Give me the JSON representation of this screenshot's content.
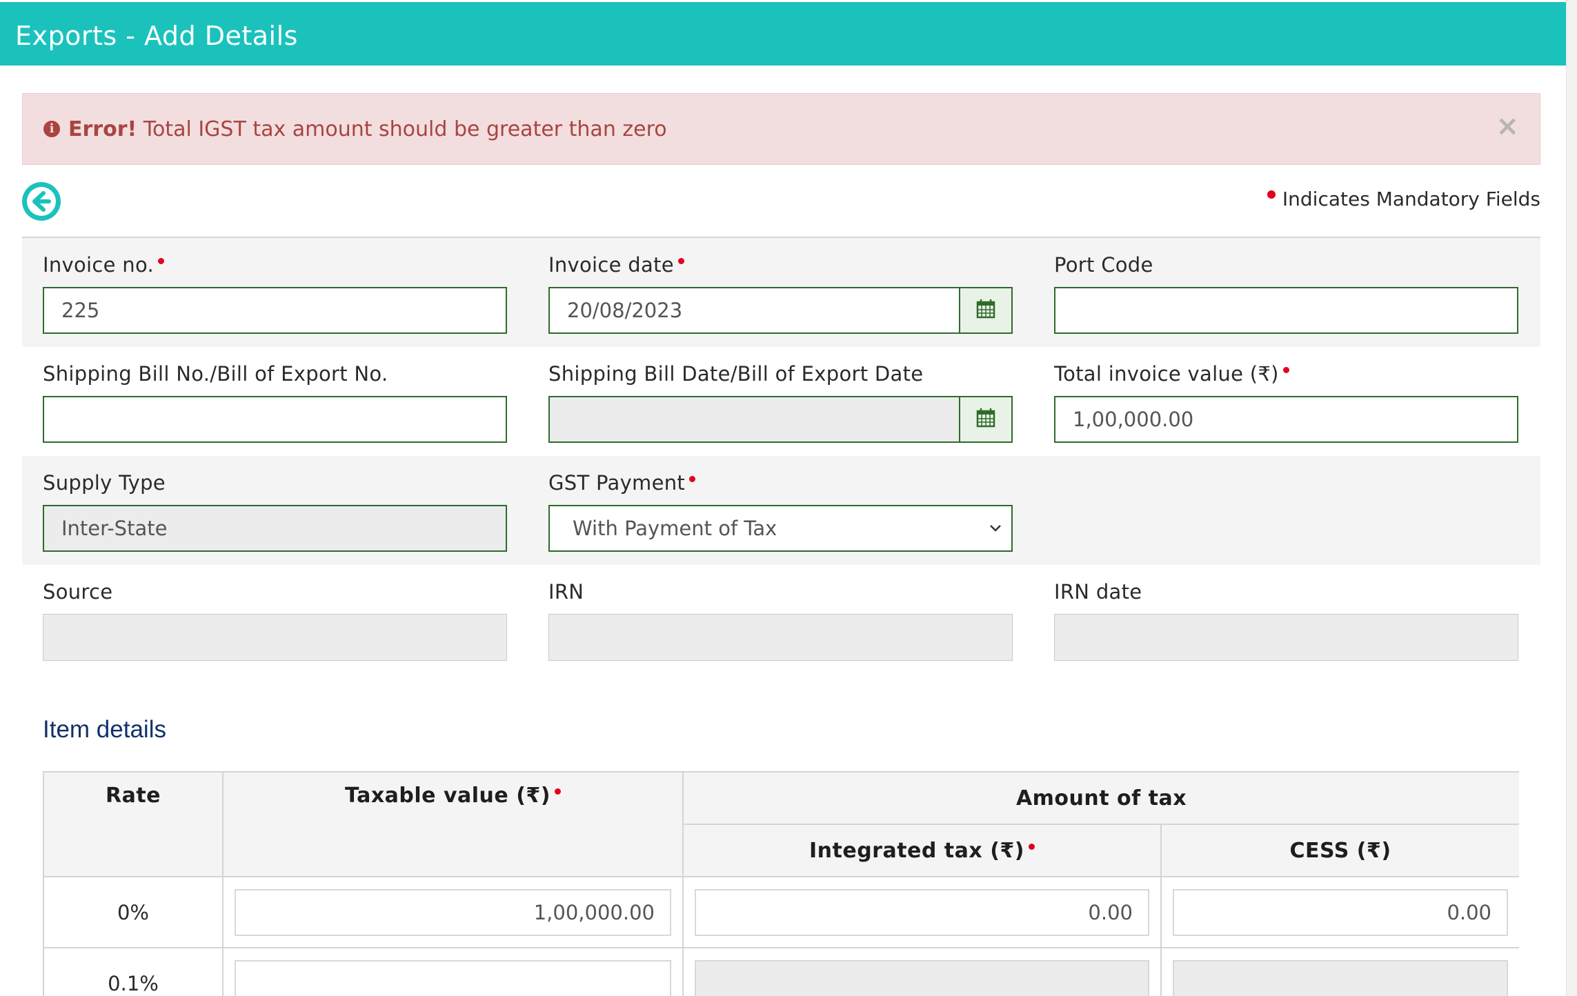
{
  "header": {
    "title": "Exports - Add Details"
  },
  "alert": {
    "strong": "Error!",
    "message": "Total IGST tax amount should be greater than zero",
    "close": "×"
  },
  "legend": {
    "mandatory_text": "Indicates Mandatory Fields"
  },
  "form": {
    "invoice_no": {
      "label": "Invoice no.",
      "value": "225",
      "required": true
    },
    "invoice_date": {
      "label": "Invoice date",
      "value": "20/08/2023",
      "required": true
    },
    "port_code": {
      "label": "Port Code",
      "value": ""
    },
    "shipping_bill_no": {
      "label": "Shipping Bill No./Bill of Export No.",
      "value": ""
    },
    "shipping_bill_date": {
      "label": "Shipping Bill Date/Bill of Export Date",
      "value": ""
    },
    "total_invoice_value": {
      "label": "Total invoice value (₹)",
      "value": "1,00,000.00",
      "required": true
    },
    "supply_type": {
      "label": "Supply Type",
      "value": "Inter-State"
    },
    "gst_payment": {
      "label": "GST Payment",
      "value": "With Payment of Tax",
      "required": true
    },
    "source": {
      "label": "Source",
      "value": ""
    },
    "irn": {
      "label": "IRN",
      "value": ""
    },
    "irn_date": {
      "label": "IRN date",
      "value": ""
    }
  },
  "items": {
    "title": "Item details",
    "headers": {
      "rate": "Rate",
      "taxable_value": "Taxable value (₹)",
      "amount_of_tax": "Amount of tax",
      "integrated_tax": "Integrated tax (₹)",
      "cess": "CESS (₹)"
    },
    "rows": [
      {
        "rate": "0%",
        "taxable_value": "1,00,000.00",
        "integrated_tax": "0.00",
        "cess": "0.00"
      },
      {
        "rate": "0.1%",
        "taxable_value": "",
        "integrated_tax": "",
        "cess": ""
      }
    ]
  },
  "colors": {
    "header": "#1bc2bc",
    "error_bg": "#f2dede",
    "error_text": "#a94442",
    "input_border": "#2e6b2a",
    "required_dot": "#e4001b"
  }
}
